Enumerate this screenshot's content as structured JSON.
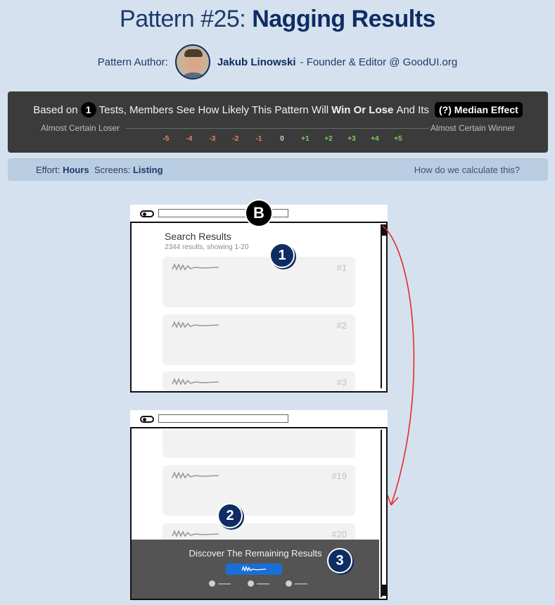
{
  "header": {
    "pattern_label": "Pattern #25:",
    "pattern_name": "Nagging Results",
    "author_label": "Pattern Author:",
    "author_name": "Jakub Linowski",
    "author_role": "- Founder & Editor @ GoodUI.org"
  },
  "stats": {
    "prefix": "Based on",
    "tests_count": "1",
    "middle": "Tests, Members See How Likely This Pattern Will",
    "emphasis": "Win Or Lose",
    "suffix": "And Its",
    "median_button": "(?) Median Effect",
    "left_label": "Almost Certain Loser",
    "right_label": "Almost Certain Winner",
    "scale": [
      "-5",
      "-4",
      "-3",
      "-2",
      "-1",
      "0",
      "+1",
      "+2",
      "+3",
      "+4",
      "+5"
    ],
    "colors": {
      "negative": "#f0845c",
      "neutral": "#d0d0d0",
      "positive": "#7fd05a"
    }
  },
  "effort_bar": {
    "effort_label": "Effort:",
    "effort_value": "Hours",
    "screens_label": "Screens:",
    "screens_value": "Listing",
    "how_link": "How do we calculate this?"
  },
  "sketch_top": {
    "variant_badge": "B",
    "heading": "Search Results",
    "subheading": "2344 results, showing 1-20",
    "cards": [
      "#1",
      "#2",
      "#3"
    ],
    "step": "1"
  },
  "sketch_bottom": {
    "cards": [
      "#19",
      "#20"
    ],
    "step_2": "2",
    "step_3": "3",
    "nag_text": "Discover The Remaining Results"
  },
  "accent_colors": {
    "brand": "#0e2d63",
    "arrow": "#e8282c",
    "cta": "#1a6fd6"
  }
}
